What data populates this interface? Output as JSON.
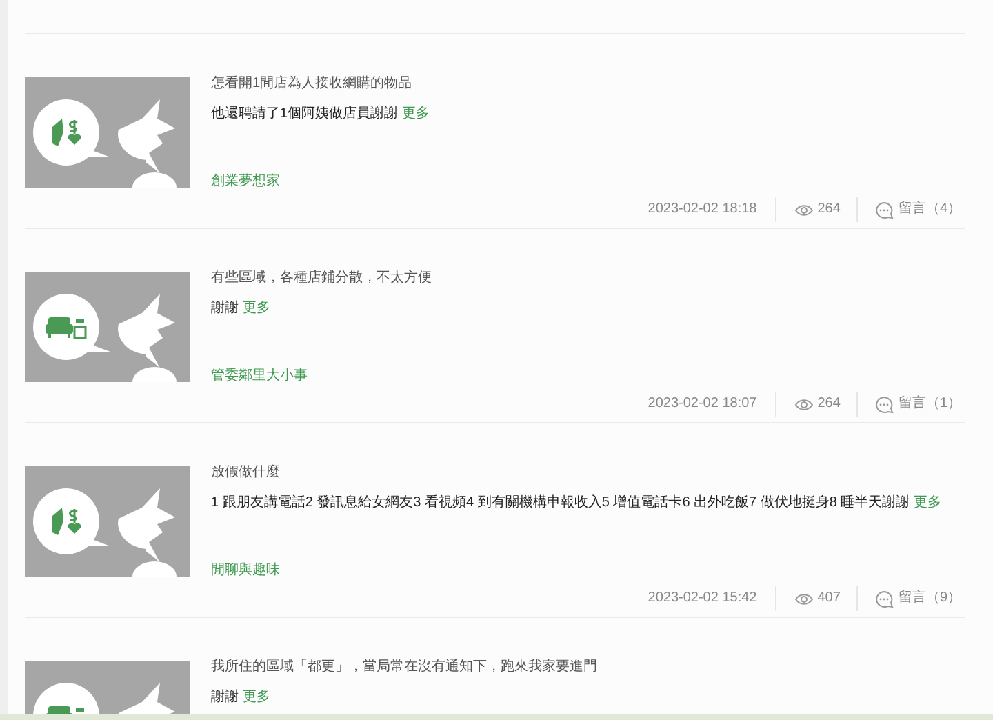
{
  "posts": [
    {
      "kind": "money",
      "title": "怎看開1間店為人接收網購的物品",
      "body": "他還聘請了1個阿姨做店員謝謝",
      "more": "更多",
      "category": "創業夢想家",
      "date": "2023-02-02 18:18",
      "views": "264",
      "comments": "留言（4）"
    },
    {
      "kind": "sofa",
      "title": "有些區域，各種店鋪分散，不太方便",
      "body": "謝謝",
      "more": "更多",
      "category": "管委鄰里大小事",
      "date": "2023-02-02 18:07",
      "views": "264",
      "comments": "留言（1）"
    },
    {
      "kind": "money",
      "title": "放假做什麼",
      "body": "1 跟朋友講電話2 發訊息給女網友3 看視頻4 到有關機構申報收入5 增值電話卡6 出外吃飯7 做伏地挺身8 睡半天謝謝",
      "more": "更多",
      "category": "閒聊與趣味",
      "date": "2023-02-02 15:42",
      "views": "407",
      "comments": "留言（9）"
    },
    {
      "kind": "sofa",
      "title": "我所住的區域「都更」，當局常在沒有通知下，跑來我家要進門",
      "body": "謝謝",
      "more": "更多"
    }
  ]
}
